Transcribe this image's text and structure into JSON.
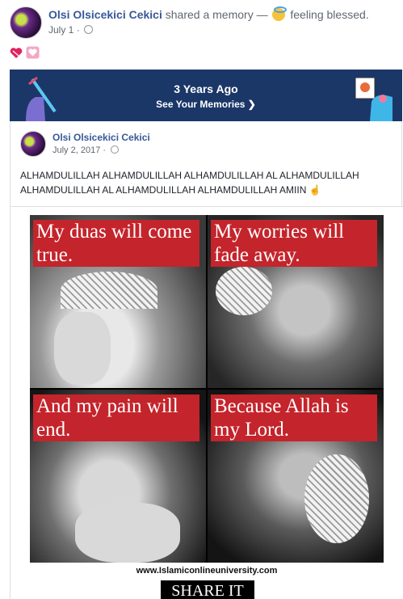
{
  "memory_post": {
    "author": "Olsi Olsicekici Cekici",
    "action_text": "shared a memory —",
    "feeling_text": "feeling blessed.",
    "date": "July 1",
    "separator": "·"
  },
  "reactions": {
    "icons": [
      "heart-emoji",
      "heart-gift-emoji"
    ]
  },
  "banner": {
    "title": "3 Years Ago",
    "link_label": "See Your Memories",
    "chevron": "❯",
    "background_color": "#1b3768"
  },
  "shared_post": {
    "author": "Olsi Olsicekici Cekici",
    "date": "July 2, 2017",
    "separator": "·",
    "text": "ALHAMDULILLAH ALHAMDULILLAH ALHAMDULILLAH AL ALHAMDULILLAH ALHAMDULILLAH AL ALHAMDULILLAH ALHAMDULILLAH AMIIN",
    "text_emoji": "☝"
  },
  "poster": {
    "captions": [
      "My duas will come true.",
      "My worries will fade away.",
      "And my pain will end.",
      "Because Allah is my Lord."
    ],
    "caption_color": "#c4242b",
    "website": "www.Islamiconlineuniversity.com",
    "share_label": "SHARE IT"
  }
}
